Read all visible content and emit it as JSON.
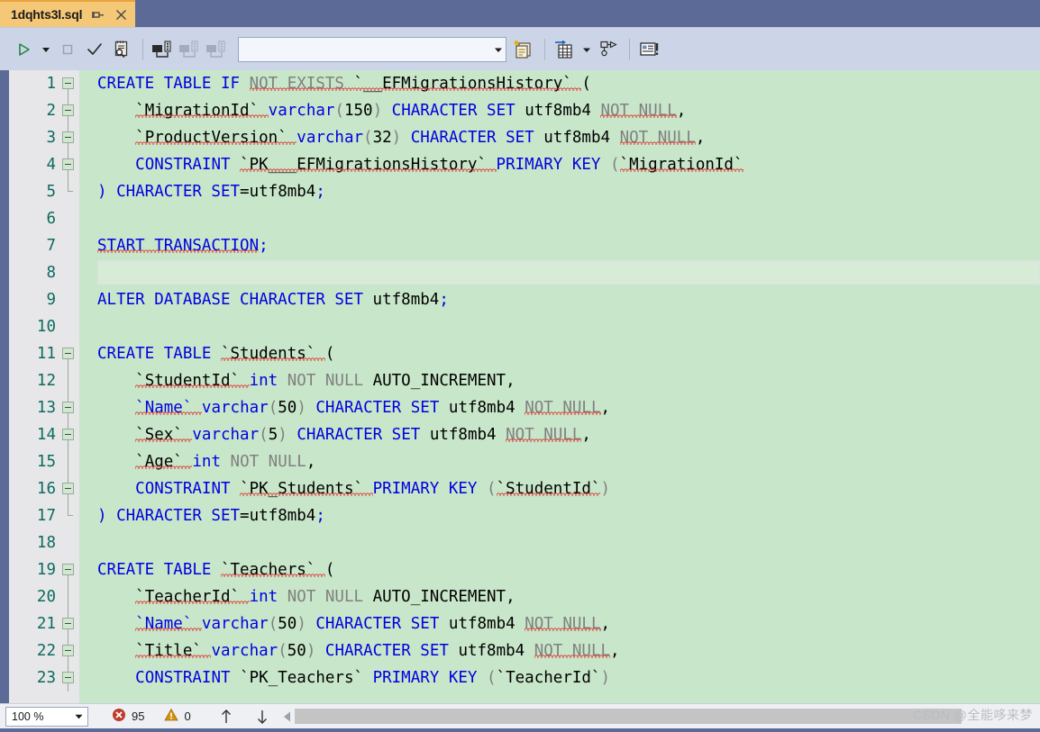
{
  "tab": {
    "title": "1dqhts3l.sql",
    "pin_icon": "pin-icon",
    "close_icon": "close-icon"
  },
  "toolbar": {
    "execute_label": "execute-query",
    "execute_dropdown_label": "execute-options",
    "stop_label": "stop-query",
    "parse_label": "parse-query",
    "query_designer_label": "query-designer",
    "connect_label": "connect",
    "disconnect_label": "disconnect",
    "change_connection_label": "change-connection",
    "database_combo_value": "",
    "database_combo_placeholder": "",
    "new_query_label": "new-query",
    "results_to_grid_label": "results-to-grid",
    "results_dropdown_label": "results-options",
    "include_plan_label": "include-execution-plan",
    "results_to_text_label": "results-to-text"
  },
  "editor": {
    "language": "sql",
    "lines": [
      {
        "n": "1",
        "fold": "open",
        "indent": 0,
        "tokens": [
          {
            "t": "CREATE TABLE ",
            "c": "kw"
          },
          {
            "t": "IF ",
            "c": "kw"
          },
          {
            "t": "NOT EXISTS ",
            "c": "gray",
            "sq": true
          },
          {
            "t": "`__EFMigrationsHistory` ",
            "c": "id",
            "sq": true
          },
          {
            "t": "(",
            "c": "id"
          }
        ]
      },
      {
        "n": "2",
        "fold": "open",
        "indent": 1,
        "tokens": [
          {
            "t": "`MigrationId` ",
            "c": "id",
            "sq": true
          },
          {
            "t": "varchar",
            "c": "kw"
          },
          {
            "t": "(",
            "c": "paren"
          },
          {
            "t": "150",
            "c": "num"
          },
          {
            "t": ")",
            "c": "paren"
          },
          {
            "t": " CHARACTER SET ",
            "c": "kw"
          },
          {
            "t": "utf8mb4 ",
            "c": "id"
          },
          {
            "t": "NOT NULL",
            "c": "gray",
            "sq": true
          },
          {
            "t": ",",
            "c": "id"
          }
        ]
      },
      {
        "n": "3",
        "fold": "open",
        "indent": 1,
        "tokens": [
          {
            "t": "`ProductVersion` ",
            "c": "id",
            "sq": true
          },
          {
            "t": "varchar",
            "c": "kw"
          },
          {
            "t": "(",
            "c": "paren"
          },
          {
            "t": "32",
            "c": "num"
          },
          {
            "t": ")",
            "c": "paren"
          },
          {
            "t": " CHARACTER SET ",
            "c": "kw"
          },
          {
            "t": "utf8mb4 ",
            "c": "id"
          },
          {
            "t": "NOT NULL",
            "c": "gray",
            "sq": true
          },
          {
            "t": ",",
            "c": "id"
          }
        ]
      },
      {
        "n": "4",
        "fold": "open",
        "indent": 1,
        "tokens": [
          {
            "t": "CONSTRAINT ",
            "c": "kw"
          },
          {
            "t": "`PK___EFMigrationsHistory` ",
            "c": "id",
            "sq": true
          },
          {
            "t": "PRIMARY KEY ",
            "c": "kw"
          },
          {
            "t": "(",
            "c": "paren"
          },
          {
            "t": "`MigrationId`",
            "c": "id",
            "sq": true
          }
        ]
      },
      {
        "n": "5",
        "fold": "end",
        "indent": 0,
        "tokens": [
          {
            "t": ") ",
            "c": "kw"
          },
          {
            "t": "CHARACTER SET",
            "c": "kw"
          },
          {
            "t": "=",
            "c": "id"
          },
          {
            "t": "utf8mb4",
            "c": "id"
          },
          {
            "t": ";",
            "c": "kw"
          }
        ]
      },
      {
        "n": "6",
        "fold": "none",
        "indent": 0,
        "tokens": []
      },
      {
        "n": "7",
        "fold": "none",
        "indent": 0,
        "tokens": [
          {
            "t": "START TRANSACTION",
            "c": "kw",
            "sq": true
          },
          {
            "t": ";",
            "c": "kw"
          }
        ]
      },
      {
        "n": "8",
        "fold": "none",
        "indent": 0,
        "current": true,
        "tokens": []
      },
      {
        "n": "9",
        "fold": "none",
        "indent": 0,
        "tokens": [
          {
            "t": "ALTER DATABASE CHARACTER SET ",
            "c": "kw"
          },
          {
            "t": "utf8mb4",
            "c": "id"
          },
          {
            "t": ";",
            "c": "kw"
          }
        ]
      },
      {
        "n": "10",
        "fold": "none",
        "indent": 0,
        "tokens": []
      },
      {
        "n": "11",
        "fold": "open",
        "indent": 0,
        "tokens": [
          {
            "t": "CREATE TABLE ",
            "c": "kw"
          },
          {
            "t": "`Students` ",
            "c": "id",
            "sq": true
          },
          {
            "t": "(",
            "c": "id"
          }
        ]
      },
      {
        "n": "12",
        "fold": "line",
        "indent": 1,
        "tokens": [
          {
            "t": "`StudentId` ",
            "c": "id",
            "sq": true
          },
          {
            "t": "int ",
            "c": "kw"
          },
          {
            "t": "NOT NULL ",
            "c": "gray"
          },
          {
            "t": "AUTO_INCREMENT",
            "c": "id"
          },
          {
            "t": ",",
            "c": "id"
          }
        ]
      },
      {
        "n": "13",
        "fold": "open",
        "indent": 1,
        "tokens": [
          {
            "t": "`Name` ",
            "c": "kw",
            "sq": true
          },
          {
            "t": "varchar",
            "c": "kw"
          },
          {
            "t": "(",
            "c": "paren"
          },
          {
            "t": "50",
            "c": "num"
          },
          {
            "t": ")",
            "c": "paren"
          },
          {
            "t": " CHARACTER SET ",
            "c": "kw"
          },
          {
            "t": "utf8mb4 ",
            "c": "id"
          },
          {
            "t": "NOT NULL",
            "c": "gray",
            "sq": true
          },
          {
            "t": ",",
            "c": "id"
          }
        ]
      },
      {
        "n": "14",
        "fold": "open",
        "indent": 1,
        "tokens": [
          {
            "t": "`Sex` ",
            "c": "id",
            "sq": true
          },
          {
            "t": "varchar",
            "c": "kw"
          },
          {
            "t": "(",
            "c": "paren"
          },
          {
            "t": "5",
            "c": "num"
          },
          {
            "t": ")",
            "c": "paren"
          },
          {
            "t": " CHARACTER SET ",
            "c": "kw"
          },
          {
            "t": "utf8mb4 ",
            "c": "id"
          },
          {
            "t": "NOT NULL",
            "c": "gray",
            "sq": true
          },
          {
            "t": ",",
            "c": "id"
          }
        ]
      },
      {
        "n": "15",
        "fold": "line",
        "indent": 1,
        "tokens": [
          {
            "t": "`Age` ",
            "c": "id",
            "sq": true
          },
          {
            "t": "int ",
            "c": "kw"
          },
          {
            "t": "NOT NULL",
            "c": "gray"
          },
          {
            "t": ",",
            "c": "id"
          }
        ]
      },
      {
        "n": "16",
        "fold": "open",
        "indent": 1,
        "tokens": [
          {
            "t": "CONSTRAINT ",
            "c": "kw"
          },
          {
            "t": "`PK_Students` ",
            "c": "id",
            "sq": true
          },
          {
            "t": "PRIMARY KEY ",
            "c": "kw"
          },
          {
            "t": "(",
            "c": "paren"
          },
          {
            "t": "`StudentId`",
            "c": "id",
            "sq": true
          },
          {
            "t": ")",
            "c": "paren"
          }
        ]
      },
      {
        "n": "17",
        "fold": "end",
        "indent": 0,
        "tokens": [
          {
            "t": ") ",
            "c": "kw"
          },
          {
            "t": "CHARACTER SET",
            "c": "kw"
          },
          {
            "t": "=",
            "c": "id"
          },
          {
            "t": "utf8mb4",
            "c": "id"
          },
          {
            "t": ";",
            "c": "kw"
          }
        ]
      },
      {
        "n": "18",
        "fold": "none",
        "indent": 0,
        "tokens": []
      },
      {
        "n": "19",
        "fold": "open",
        "indent": 0,
        "tokens": [
          {
            "t": "CREATE TABLE ",
            "c": "kw"
          },
          {
            "t": "`Teachers` ",
            "c": "id",
            "sq": true
          },
          {
            "t": "(",
            "c": "id"
          }
        ]
      },
      {
        "n": "20",
        "fold": "line",
        "indent": 1,
        "tokens": [
          {
            "t": "`TeacherId` ",
            "c": "id",
            "sq": true
          },
          {
            "t": "int ",
            "c": "kw"
          },
          {
            "t": "NOT NULL ",
            "c": "gray"
          },
          {
            "t": "AUTO_INCREMENT",
            "c": "id"
          },
          {
            "t": ",",
            "c": "id"
          }
        ]
      },
      {
        "n": "21",
        "fold": "open",
        "indent": 1,
        "tokens": [
          {
            "t": "`Name` ",
            "c": "kw",
            "sq": true
          },
          {
            "t": "varchar",
            "c": "kw"
          },
          {
            "t": "(",
            "c": "paren"
          },
          {
            "t": "50",
            "c": "num"
          },
          {
            "t": ")",
            "c": "paren"
          },
          {
            "t": " CHARACTER SET ",
            "c": "kw"
          },
          {
            "t": "utf8mb4 ",
            "c": "id"
          },
          {
            "t": "NOT NULL",
            "c": "gray",
            "sq": true
          },
          {
            "t": ",",
            "c": "id"
          }
        ]
      },
      {
        "n": "22",
        "fold": "open",
        "indent": 1,
        "tokens": [
          {
            "t": "`Title` ",
            "c": "id",
            "sq": true
          },
          {
            "t": "varchar",
            "c": "kw"
          },
          {
            "t": "(",
            "c": "paren"
          },
          {
            "t": "50",
            "c": "num"
          },
          {
            "t": ")",
            "c": "paren"
          },
          {
            "t": " CHARACTER SET ",
            "c": "kw"
          },
          {
            "t": "utf8mb4 ",
            "c": "id"
          },
          {
            "t": "NOT NULL",
            "c": "gray",
            "sq": true
          },
          {
            "t": ",",
            "c": "id"
          }
        ]
      },
      {
        "n": "23",
        "fold": "open",
        "indent": 1,
        "clipped": true,
        "tokens": [
          {
            "t": "CONSTRAINT ",
            "c": "kw"
          },
          {
            "t": "`PK_Teachers` ",
            "c": "id"
          },
          {
            "t": "PRIMARY KEY ",
            "c": "kw"
          },
          {
            "t": "(",
            "c": "paren"
          },
          {
            "t": "`TeacherId`",
            "c": "id"
          },
          {
            "t": ")",
            "c": "paren"
          }
        ]
      }
    ]
  },
  "statusbar": {
    "zoom": "100 %",
    "error_count": "95",
    "warning_count": "0",
    "prev_label": "previous-issue",
    "next_label": "next-issue"
  },
  "watermark": {
    "text": "CSDN @全能哆来梦"
  },
  "colors": {
    "tab_active": "#f5c877",
    "tab_border": "#e8a33d",
    "titlebar": "#5b6a96",
    "toolbar": "#ccd5e8",
    "editor_bg": "#c8e6c9",
    "current_line": "#d6ecd7",
    "gutter": "#e7e7e9",
    "keyword": "#0000e0",
    "gray_token": "#808080",
    "identifier": "#000000",
    "linenum": "#0c6b5e",
    "error_red": "#c0392b",
    "warn_amber": "#d4930a",
    "squiggle": "#e03131"
  }
}
